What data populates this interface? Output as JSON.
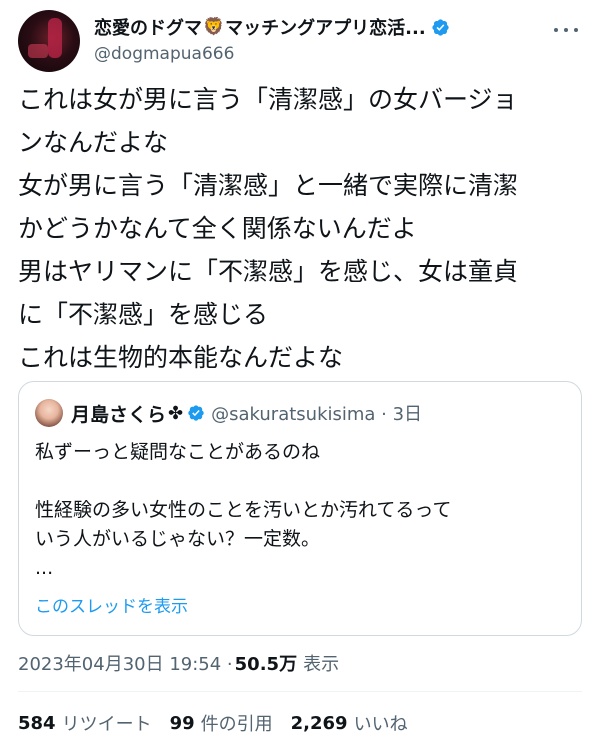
{
  "author": {
    "name_part1": "恋愛のドグマ",
    "emoji": "🦁",
    "name_part2": "マッチングアプリ恋活...",
    "handle": "@dogmapua666"
  },
  "tweet_lines": [
    "これは女が男に言う「清潔感」の女バージョ",
    "ンなんだよな",
    "女が男に言う「清潔感」と一緒で実際に清潔",
    "かどうかなんて全く関係ないんだよ",
    "男はヤリマンに「不潔感」を感じ、女は童貞",
    "に「不潔感」を感じる",
    "これは生物的本能なんだよな"
  ],
  "quoted": {
    "name": "月島さくら",
    "emoji": "✤",
    "handle_time": "@sakuratsukisima · 3日",
    "lines": [
      "私ずーっと疑問なことがあるのね",
      "",
      "性経験の多い女性のことを汚いとか汚れてるって",
      "いう人がいるじゃない？一定数。",
      "..."
    ],
    "thread_link": "このスレッドを表示"
  },
  "meta": {
    "timestamp": "2023年04月30日 19:54 · ",
    "views": "50.5万",
    "views_label": "表示"
  },
  "stats": {
    "retweets": "584",
    "retweets_label": "リツイート",
    "quotes": "99",
    "quotes_label": "件の引用",
    "likes": "2,269",
    "likes_label": "いいね"
  },
  "colors": {
    "verified": "#1d9bf0",
    "link": "#1d9bf0",
    "muted": "#536471",
    "text": "#0f1419"
  }
}
